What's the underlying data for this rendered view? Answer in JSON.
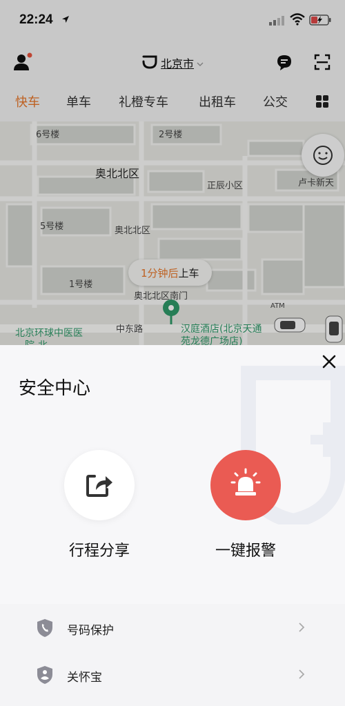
{
  "status_bar": {
    "time": "22:24",
    "icons": [
      "location-arrow-icon",
      "signal-icon",
      "wifi-icon",
      "battery-charging-icon"
    ]
  },
  "header": {
    "city": "北京市",
    "icons": [
      "person-icon",
      "message-icon",
      "scan-icon",
      "didi-logo-icon"
    ]
  },
  "tabs": [
    {
      "label": "快车",
      "active": true
    },
    {
      "label": "单车",
      "active": false
    },
    {
      "label": "礼橙专车",
      "active": false
    },
    {
      "label": "出租车",
      "active": false
    },
    {
      "label": "公交",
      "active": false
    }
  ],
  "map": {
    "labels": {
      "bldg6": "6号楼",
      "bldg2": "2号楼",
      "north_district": "奥北北区",
      "zhengchen": "正辰小区",
      "lubu": "卢卡新天",
      "bldg5": "5号楼",
      "aobei_poi": "奥北北区",
      "bldg1": "1号楼",
      "south_gate": "奥北北区南门",
      "hospital_line1": "北京环球中医医",
      "hospital_line2": "院-北",
      "zhongdong_road": "中东路",
      "hotel_line1": "汉庭酒店(北京天通",
      "hotel_line2": "苑龙德广场店)",
      "atm": "ATM"
    },
    "pickup_time": "1分钟后",
    "pickup_action": "上车",
    "accent_color": "#2f9a6a"
  },
  "safety": {
    "title": "安全中心",
    "share_label": "行程分享",
    "alarm_label": "一键报警",
    "alarm_color": "#ea5b53",
    "items": [
      {
        "label": "号码保护",
        "icon": "shield-phone-icon"
      },
      {
        "label": "关怀宝",
        "icon": "shield-heart-icon"
      }
    ]
  },
  "colors": {
    "accent": "#e8772a"
  }
}
